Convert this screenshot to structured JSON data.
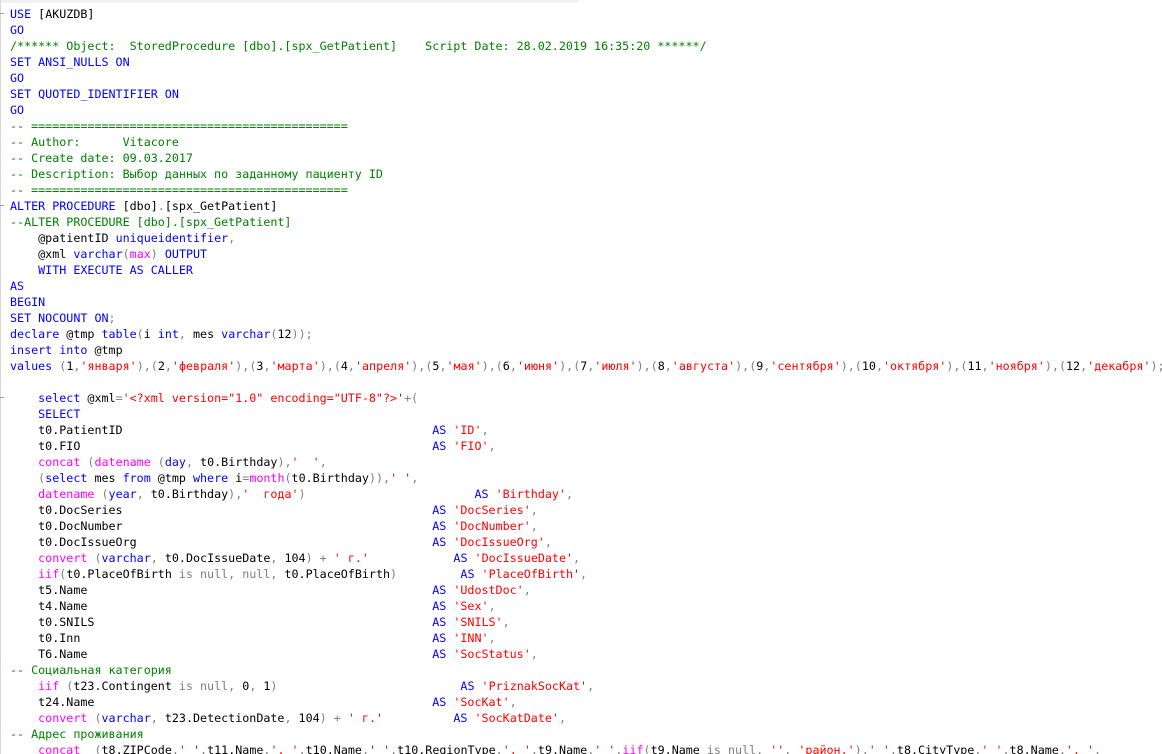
{
  "colors": {
    "keyword": "#0000ff",
    "string": "#ff0000",
    "comment": "#008000",
    "operator": "#808080",
    "function": "#ff00ff",
    "identifier": "#000000",
    "background": "#ffffff"
  },
  "editor": {
    "lines": [
      [
        [
          "k",
          "USE "
        ],
        [
          "p",
          "[AKUZDB]"
        ]
      ],
      [
        [
          "k",
          "GO"
        ]
      ],
      [
        [
          "c",
          "/****** Object:  StoredProcedure [dbo].[spx_GetPatient]    Script Date: 28.02.2019 16:35:20 ******/"
        ]
      ],
      [
        [
          "k",
          "SET ANSI_NULLS ON"
        ]
      ],
      [
        [
          "k",
          "GO"
        ]
      ],
      [
        [
          "k",
          "SET QUOTED_IDENTIFIER ON"
        ]
      ],
      [
        [
          "k",
          "GO"
        ]
      ],
      [
        [
          "c",
          "-- ============================================="
        ]
      ],
      [
        [
          "c",
          "-- Author:      Vitacore"
        ]
      ],
      [
        [
          "c",
          "-- Create date: 09.03.2017"
        ]
      ],
      [
        [
          "c",
          "-- Description: Выбор данных по заданному пациенту ID"
        ]
      ],
      [
        [
          "c",
          "-- ============================================="
        ]
      ],
      [
        [
          "k",
          "ALTER PROCEDURE "
        ],
        [
          "p",
          "[dbo]"
        ],
        [
          "g",
          "."
        ],
        [
          "p",
          "[spx_GetPatient]"
        ]
      ],
      [
        [
          "c",
          "--ALTER PROCEDURE [dbo].[spx_GetPatient]"
        ]
      ],
      [
        [
          "p",
          "    @patientID "
        ],
        [
          "k",
          "uniqueidentifier"
        ],
        [
          "g",
          ","
        ]
      ],
      [
        [
          "p",
          "    @xml "
        ],
        [
          "k",
          "varchar"
        ],
        [
          "g",
          "("
        ],
        [
          "f",
          "max"
        ],
        [
          "g",
          ")"
        ],
        [
          "k",
          " OUTPUT"
        ]
      ],
      [
        [
          "k",
          "    WITH EXECUTE AS CALLER"
        ]
      ],
      [
        [
          "k",
          "AS"
        ]
      ],
      [
        [
          "k",
          "BEGIN"
        ]
      ],
      [
        [
          "k",
          "SET NOCOUNT ON"
        ],
        [
          "g",
          ";"
        ]
      ],
      [
        [
          "k",
          "declare "
        ],
        [
          "p",
          "@tmp "
        ],
        [
          "k",
          "table"
        ],
        [
          "g",
          "("
        ],
        [
          "p",
          "i "
        ],
        [
          "k",
          "int"
        ],
        [
          "g",
          ", "
        ],
        [
          "p",
          "mes "
        ],
        [
          "k",
          "varchar"
        ],
        [
          "g",
          "("
        ],
        [
          "p",
          "12"
        ],
        [
          "g",
          "));"
        ]
      ],
      [
        [
          "k",
          "insert into "
        ],
        [
          "p",
          "@tmp"
        ]
      ],
      [
        [
          "k",
          "values "
        ],
        [
          "g",
          "("
        ],
        [
          "p",
          "1"
        ],
        [
          "g",
          ","
        ],
        [
          "s",
          "'января'"
        ],
        [
          "g",
          "),("
        ],
        [
          "p",
          "2"
        ],
        [
          "g",
          ","
        ],
        [
          "s",
          "'февраля'"
        ],
        [
          "g",
          "),("
        ],
        [
          "p",
          "3"
        ],
        [
          "g",
          ","
        ],
        [
          "s",
          "'марта'"
        ],
        [
          "g",
          "),("
        ],
        [
          "p",
          "4"
        ],
        [
          "g",
          ","
        ],
        [
          "s",
          "'апреля'"
        ],
        [
          "g",
          "),("
        ],
        [
          "p",
          "5"
        ],
        [
          "g",
          ","
        ],
        [
          "s",
          "'мая'"
        ],
        [
          "g",
          "),("
        ],
        [
          "p",
          "6"
        ],
        [
          "g",
          ","
        ],
        [
          "s",
          "'июня'"
        ],
        [
          "g",
          "),("
        ],
        [
          "p",
          "7"
        ],
        [
          "g",
          ","
        ],
        [
          "s",
          "'июля'"
        ],
        [
          "g",
          "),("
        ],
        [
          "p",
          "8"
        ],
        [
          "g",
          ","
        ],
        [
          "s",
          "'августа'"
        ],
        [
          "g",
          "),("
        ],
        [
          "p",
          "9"
        ],
        [
          "g",
          ","
        ],
        [
          "s",
          "'сентября'"
        ],
        [
          "g",
          "),("
        ],
        [
          "p",
          "10"
        ],
        [
          "g",
          ","
        ],
        [
          "s",
          "'октября'"
        ],
        [
          "g",
          "),("
        ],
        [
          "p",
          "11"
        ],
        [
          "g",
          ","
        ],
        [
          "s",
          "'ноября'"
        ],
        [
          "g",
          "),("
        ],
        [
          "p",
          "12"
        ],
        [
          "g",
          ","
        ],
        [
          "s",
          "'декабря'"
        ],
        [
          "g",
          ");"
        ]
      ],
      [],
      [
        [
          "k",
          "    select "
        ],
        [
          "p",
          "@xml"
        ],
        [
          "g",
          "="
        ],
        [
          "s",
          "'<?xml version=\"1.0\" encoding=\"UTF-8\"?>'"
        ],
        [
          "g",
          "+("
        ]
      ],
      [
        [
          "k",
          "    SELECT"
        ]
      ],
      [
        [
          "p",
          "    t0.PatientID                                            "
        ],
        [
          "k",
          "AS "
        ],
        [
          "s",
          "'ID'"
        ],
        [
          "g",
          ","
        ]
      ],
      [
        [
          "p",
          "    t0.FIO                                                  "
        ],
        [
          "k",
          "AS "
        ],
        [
          "s",
          "'FIO'"
        ],
        [
          "g",
          ","
        ]
      ],
      [
        [
          "f",
          "    concat "
        ],
        [
          "g",
          "("
        ],
        [
          "f",
          "datename "
        ],
        [
          "g",
          "("
        ],
        [
          "k",
          "day"
        ],
        [
          "g",
          ", "
        ],
        [
          "p",
          "t0.Birthday"
        ],
        [
          "g",
          "),"
        ],
        [
          "s",
          "'  '"
        ],
        [
          "g",
          ","
        ]
      ],
      [
        [
          "g",
          "    ("
        ],
        [
          "k",
          "select "
        ],
        [
          "p",
          "mes "
        ],
        [
          "k",
          "from "
        ],
        [
          "p",
          "@tmp "
        ],
        [
          "k",
          "where "
        ],
        [
          "p",
          "i"
        ],
        [
          "g",
          "="
        ],
        [
          "f",
          "month"
        ],
        [
          "g",
          "("
        ],
        [
          "p",
          "t0.Birthday"
        ],
        [
          "g",
          ")),"
        ],
        [
          "s",
          "' '"
        ],
        [
          "g",
          ","
        ]
      ],
      [
        [
          "f",
          "    datename "
        ],
        [
          "g",
          "("
        ],
        [
          "k",
          "year"
        ],
        [
          "g",
          ", "
        ],
        [
          "p",
          "t0.Birthday"
        ],
        [
          "g",
          "),"
        ],
        [
          "s",
          "'  года'"
        ],
        [
          "g",
          ")                        "
        ],
        [
          "k",
          "AS "
        ],
        [
          "s",
          "'Birthday'"
        ],
        [
          "g",
          ","
        ]
      ],
      [
        [
          "p",
          "    t0.DocSeries                                            "
        ],
        [
          "k",
          "AS "
        ],
        [
          "s",
          "'DocSeries'"
        ],
        [
          "g",
          ","
        ]
      ],
      [
        [
          "p",
          "    t0.DocNumber                                            "
        ],
        [
          "k",
          "AS "
        ],
        [
          "s",
          "'DocNumber'"
        ],
        [
          "g",
          ","
        ]
      ],
      [
        [
          "p",
          "    t0.DocIssueOrg                                          "
        ],
        [
          "k",
          "AS "
        ],
        [
          "s",
          "'DocIssueOrg'"
        ],
        [
          "g",
          ","
        ]
      ],
      [
        [
          "f",
          "    convert "
        ],
        [
          "g",
          "("
        ],
        [
          "k",
          "varchar"
        ],
        [
          "g",
          ", "
        ],
        [
          "p",
          "t0.DocIssueDate"
        ],
        [
          "g",
          ", "
        ],
        [
          "p",
          "104"
        ],
        [
          "g",
          ") + "
        ],
        [
          "s",
          "' г.'"
        ],
        [
          "p",
          "            "
        ],
        [
          "k",
          "AS "
        ],
        [
          "s",
          "'DocIssueDate'"
        ],
        [
          "g",
          ","
        ]
      ],
      [
        [
          "f",
          "    iif"
        ],
        [
          "g",
          "("
        ],
        [
          "p",
          "t0.PlaceOfBirth "
        ],
        [
          "g",
          "is null, null, "
        ],
        [
          "p",
          "t0.PlaceOfBirth"
        ],
        [
          "g",
          ")         "
        ],
        [
          "k",
          "AS "
        ],
        [
          "s",
          "'PlaceOfBirth'"
        ],
        [
          "g",
          ","
        ]
      ],
      [
        [
          "p",
          "    t5.Name                                                 "
        ],
        [
          "k",
          "AS "
        ],
        [
          "s",
          "'UdostDoc'"
        ],
        [
          "g",
          ","
        ]
      ],
      [
        [
          "p",
          "    t4.Name                                                 "
        ],
        [
          "k",
          "AS "
        ],
        [
          "s",
          "'Sex'"
        ],
        [
          "g",
          ","
        ]
      ],
      [
        [
          "p",
          "    t0.SNILS                                                "
        ],
        [
          "k",
          "AS "
        ],
        [
          "s",
          "'SNILS'"
        ],
        [
          "g",
          ","
        ]
      ],
      [
        [
          "p",
          "    t0.Inn                                                  "
        ],
        [
          "k",
          "AS "
        ],
        [
          "s",
          "'INN'"
        ],
        [
          "g",
          ","
        ]
      ],
      [
        [
          "p",
          "    T6.Name                                                 "
        ],
        [
          "k",
          "AS "
        ],
        [
          "s",
          "'SocStatus'"
        ],
        [
          "g",
          ","
        ]
      ],
      [
        [
          "c",
          "-- Социальная категория"
        ]
      ],
      [
        [
          "f",
          "    iif "
        ],
        [
          "g",
          "("
        ],
        [
          "p",
          "t23.Contingent "
        ],
        [
          "g",
          "is null, "
        ],
        [
          "p",
          "0"
        ],
        [
          "g",
          ", "
        ],
        [
          "p",
          "1"
        ],
        [
          "g",
          ")                          "
        ],
        [
          "k",
          "AS "
        ],
        [
          "s",
          "'PriznakSocKat'"
        ],
        [
          "g",
          ","
        ]
      ],
      [
        [
          "p",
          "    t24.Name                                                "
        ],
        [
          "k",
          "AS "
        ],
        [
          "s",
          "'SocKat'"
        ],
        [
          "g",
          ","
        ]
      ],
      [
        [
          "f",
          "    convert "
        ],
        [
          "g",
          "("
        ],
        [
          "k",
          "varchar"
        ],
        [
          "g",
          ", "
        ],
        [
          "p",
          "t23.DetectionDate"
        ],
        [
          "g",
          ", "
        ],
        [
          "p",
          "104"
        ],
        [
          "g",
          ") + "
        ],
        [
          "s",
          "' г.'"
        ],
        [
          "p",
          "          "
        ],
        [
          "k",
          "AS "
        ],
        [
          "s",
          "'SocKatDate'"
        ],
        [
          "g",
          ","
        ]
      ],
      [
        [
          "c",
          "-- Адрес проживания"
        ]
      ],
      [
        [
          "f",
          "    concat  "
        ],
        [
          "g",
          "("
        ],
        [
          "p",
          "t8.ZIPCode"
        ],
        [
          "g",
          ","
        ],
        [
          "s",
          "' '"
        ],
        [
          "g",
          ","
        ],
        [
          "p",
          "t11.Name"
        ],
        [
          "g",
          ","
        ],
        [
          "s",
          "'. '"
        ],
        [
          "g",
          ","
        ],
        [
          "p",
          "t10.Name"
        ],
        [
          "g",
          ","
        ],
        [
          "s",
          "' '"
        ],
        [
          "g",
          ","
        ],
        [
          "p",
          "t10.RegionType"
        ],
        [
          "g",
          ","
        ],
        [
          "s",
          "'. '"
        ],
        [
          "g",
          ","
        ],
        [
          "p",
          "t9.Name"
        ],
        [
          "g",
          ","
        ],
        [
          "s",
          "' '"
        ],
        [
          "g",
          ","
        ],
        [
          "f",
          "iif"
        ],
        [
          "g",
          "("
        ],
        [
          "p",
          "t9.Name "
        ],
        [
          "g",
          "is null, "
        ],
        [
          "s",
          "''"
        ],
        [
          "g",
          ", "
        ],
        [
          "s",
          "'район.'"
        ],
        [
          "g",
          "),"
        ],
        [
          "s",
          "' '"
        ],
        [
          "g",
          ","
        ],
        [
          "p",
          "t8.CityType"
        ],
        [
          "g",
          ","
        ],
        [
          "s",
          "' '"
        ],
        [
          "g",
          ","
        ],
        [
          "p",
          "t8.Name"
        ],
        [
          "g",
          ","
        ],
        [
          "s",
          "'. '"
        ],
        [
          "g",
          ","
        ]
      ]
    ]
  }
}
